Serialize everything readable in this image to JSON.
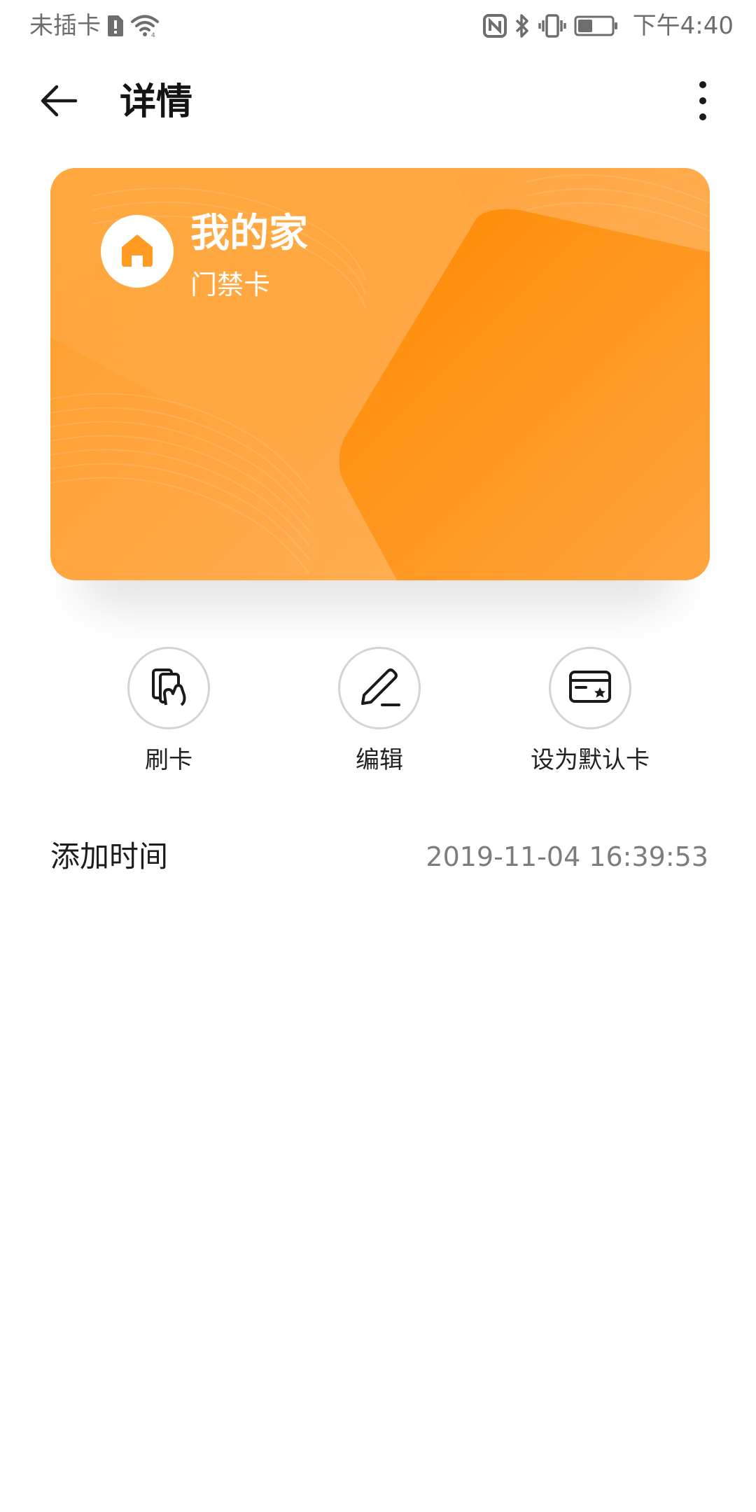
{
  "status_bar": {
    "carrier": "未插卡",
    "time": "下午4:40",
    "icons": [
      "sim-alert-icon",
      "wifi-icon",
      "nfc-icon",
      "bluetooth-icon",
      "vibrate-icon",
      "battery-icon"
    ]
  },
  "app_bar": {
    "title": "详情",
    "back_icon": "arrow-left-icon",
    "more_icon": "more-vertical-icon"
  },
  "card": {
    "name": "我的家",
    "type": "门禁卡",
    "icon": "home-icon",
    "accent_color": "#ff9a22"
  },
  "actions": [
    {
      "label": "刷卡",
      "icon": "swipe-card-icon"
    },
    {
      "label": "编辑",
      "icon": "pencil-icon"
    },
    {
      "label": "设为默认卡",
      "icon": "card-star-icon"
    }
  ],
  "details": {
    "added_time_label": "添加时间",
    "added_time_value": "2019-11-04 16:39:53"
  }
}
